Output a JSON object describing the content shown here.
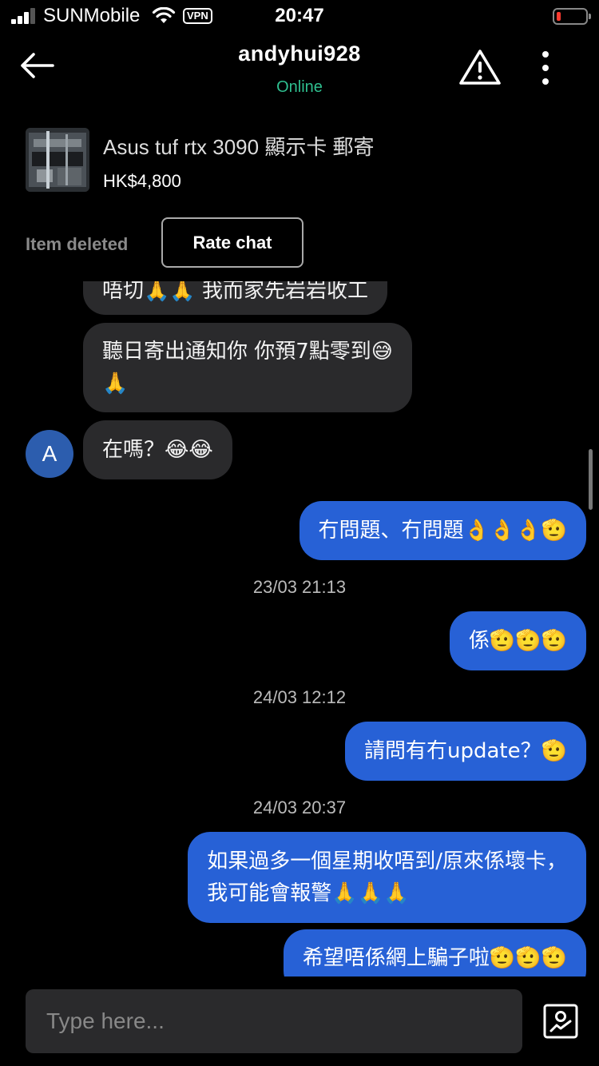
{
  "status_bar": {
    "carrier": "SUNMobile",
    "vpn": "VPN",
    "time": "20:47"
  },
  "header": {
    "title": "andyhui928",
    "status": "Online",
    "status_color": "#2fbf8f"
  },
  "listing": {
    "title": "Asus tuf rtx 3090 顯示卡 郵寄",
    "price": "HK$4,800"
  },
  "item_state": "Item deleted",
  "rate_chat_label": "Rate chat",
  "messages": {
    "in_1": "唔切🙏🙏 我而家先岩岩收工",
    "in_2_line1": "聽日寄出通知你 你預7點零到😅",
    "in_2_line2": "🙏",
    "in_3": "在嗎？😂😂",
    "avatar_letter": "A",
    "out_1": "冇問題、冇問題👌👌👌🫡",
    "ts_1": "23/03 21:13",
    "out_2": "係🫡🫡🫡",
    "ts_2": "24/03 12:12",
    "out_3": "請問有冇update？🫡",
    "ts_3": "24/03 20:37",
    "out_4_line1": "如果過多一個星期收唔到/原來係壞卡，",
    "out_4_line2": "我可能會報警🙏🙏🙏",
    "out_5": "希望唔係網上騙子啦🫡🫡🫡"
  },
  "composer": {
    "placeholder": "Type here..."
  },
  "colors": {
    "outgoing_bubble": "#2761d6",
    "incoming_bubble": "#2a2a2c",
    "battery_low": "#ff3b30"
  }
}
